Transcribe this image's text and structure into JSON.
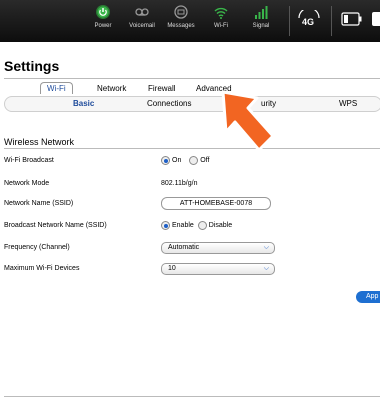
{
  "topbar": {
    "items": [
      {
        "label": "Power",
        "icon": "power-icon",
        "color": "#39b54a"
      },
      {
        "label": "Voicemail",
        "icon": "voicemail-icon",
        "color": "#888888"
      },
      {
        "label": "Messages",
        "icon": "messages-icon",
        "color": "#888888"
      },
      {
        "label": "Wi-Fi",
        "icon": "wifi-icon",
        "color": "#39b54a"
      },
      {
        "label": "Signal",
        "icon": "signal-icon",
        "color": "#39b54a"
      }
    ],
    "network_badge": "4G"
  },
  "page": {
    "title": "Settings"
  },
  "tabs": [
    {
      "label": "Wi-Fi",
      "active": true
    },
    {
      "label": "Network"
    },
    {
      "label": "Firewall"
    },
    {
      "label": "Advanced"
    }
  ],
  "subtabs": [
    {
      "label": "Basic",
      "active": true
    },
    {
      "label": "Connections"
    },
    {
      "label": "urity"
    },
    {
      "label": "WPS"
    }
  ],
  "section": {
    "title": "Wireless Network"
  },
  "fields": {
    "broadcast": {
      "label": "Wi-Fi Broadcast",
      "on": "On",
      "off": "Off",
      "selected": "On"
    },
    "mode": {
      "label": "Network Mode",
      "value": "802.11b/g/n"
    },
    "ssid": {
      "label": "Network Name (SSID)",
      "value": "ATT-HOMEBASE-0078"
    },
    "broadcast_ssid": {
      "label": "Broadcast Network Name (SSID)",
      "enable": "Enable",
      "disable": "Disable",
      "selected": "Enable"
    },
    "frequency": {
      "label": "Frequency (Channel)",
      "value": "Automatic"
    },
    "max_devices": {
      "label": "Maximum Wi-Fi Devices",
      "value": "10"
    }
  },
  "apply_label": "App",
  "colors": {
    "accent": "#1e5fc7",
    "arrow": "#f26522"
  }
}
